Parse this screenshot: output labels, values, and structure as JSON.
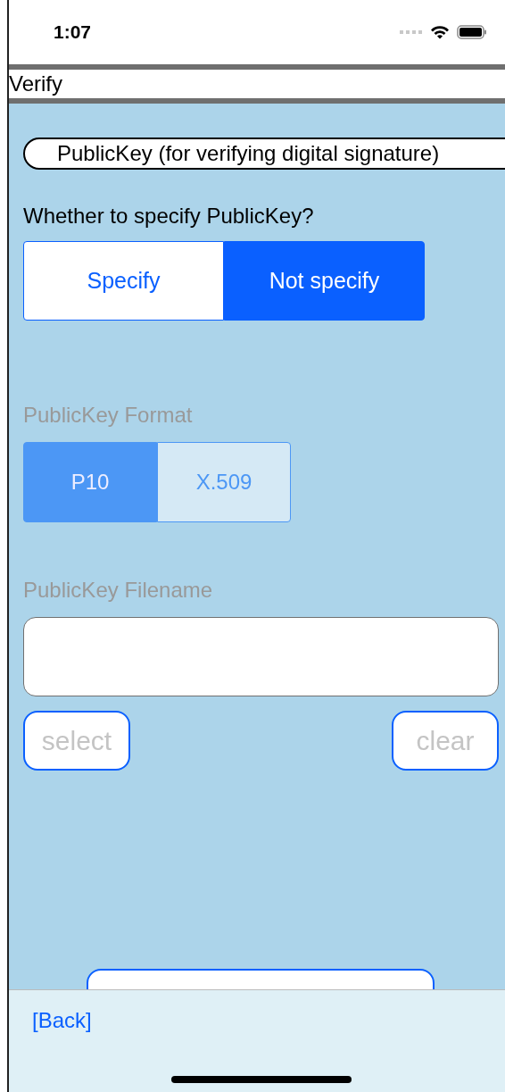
{
  "status_bar": {
    "time": "1:07"
  },
  "title": "Verify",
  "section_heading": "PublicKey (for verifying digital signature)",
  "specify_question": "Whether to specify PublicKey?",
  "specify_options": [
    {
      "label": "Specify",
      "selected": false
    },
    {
      "label": "Not specify",
      "selected": true
    }
  ],
  "format": {
    "label": "PublicKey Format",
    "disabled": true,
    "options": [
      {
        "label": "P10",
        "selected": true
      },
      {
        "label": "X.509",
        "selected": false
      }
    ]
  },
  "filename": {
    "label": "PublicKey Filename",
    "disabled": true
  },
  "file_buttons": [
    {
      "label": "select",
      "disabled": true
    },
    {
      "label": "clear",
      "disabled": true
    }
  ],
  "back_link": "[Back]"
}
